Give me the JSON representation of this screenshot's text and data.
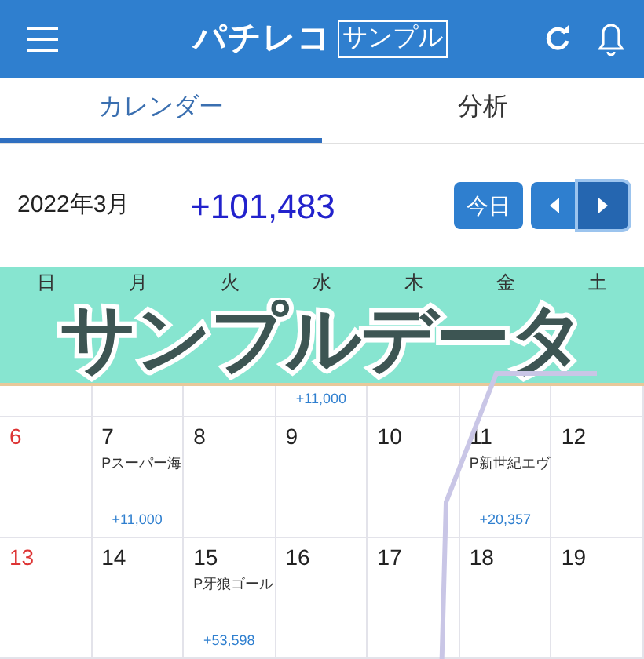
{
  "header": {
    "title": "パチレコ",
    "badge": "サンプル"
  },
  "tabs": [
    {
      "label": "カレンダー",
      "selected": true
    },
    {
      "label": "分析",
      "selected": false
    }
  ],
  "month": {
    "label": "2022年3月",
    "total": "+101,483",
    "today_button": "今日"
  },
  "weekdays": [
    "日",
    "月",
    "火",
    "水",
    "木",
    "金",
    "土"
  ],
  "banner": "サンプルデータ",
  "first_week": {
    "wednesday_amount": "+11,000"
  },
  "weeks": [
    [
      {
        "day": "6"
      },
      {
        "day": "7",
        "shop": "Pスーパー海",
        "amount": "+11,000"
      },
      {
        "day": "8"
      },
      {
        "day": "9"
      },
      {
        "day": "10"
      },
      {
        "day": "11",
        "shop": "P新世紀エヴ",
        "amount": "+20,357"
      },
      {
        "day": "12"
      }
    ],
    [
      {
        "day": "13"
      },
      {
        "day": "14"
      },
      {
        "day": "15",
        "shop": "P牙狼ゴール",
        "amount": "+53,598"
      },
      {
        "day": "16"
      },
      {
        "day": "17"
      },
      {
        "day": "18"
      },
      {
        "day": "19"
      }
    ]
  ]
}
